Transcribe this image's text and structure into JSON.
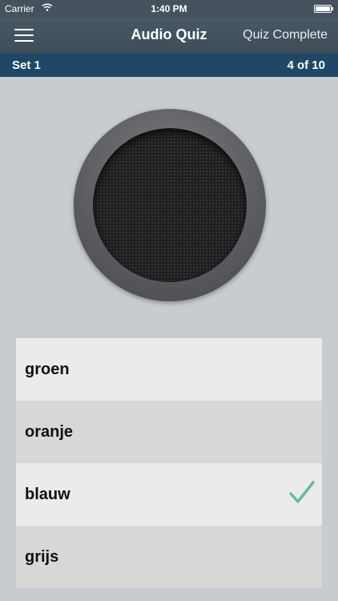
{
  "status_bar": {
    "carrier": "Carrier",
    "time": "1:40 PM",
    "wifi_icon": "wifi-icon",
    "battery_icon": "battery-icon"
  },
  "nav": {
    "menu_icon": "hamburger-menu-icon",
    "title": "Audio Quiz",
    "right_action": "Quiz Complete"
  },
  "set_bar": {
    "label": "Set 1",
    "progress": "4 of 10"
  },
  "speaker": {
    "icon": "speaker-icon"
  },
  "answers": [
    {
      "label": "groen"
    },
    {
      "label": "oranje"
    },
    {
      "label": "blauw",
      "selected": true
    },
    {
      "label": "grijs"
    }
  ],
  "colors": {
    "nav_bg": "#45525e",
    "set_bar_bg": "#1f4866",
    "background": "#c8ccd0",
    "check": "#67b9a0"
  }
}
